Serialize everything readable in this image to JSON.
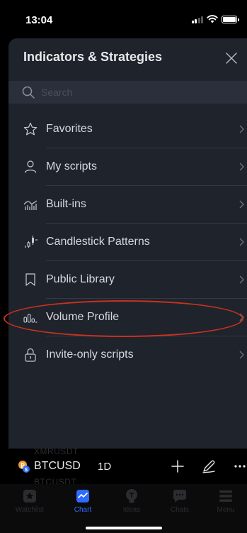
{
  "status_bar": {
    "time": "13:04"
  },
  "panel": {
    "title": "Indicators & Strategies",
    "search_placeholder": "Search",
    "items": [
      {
        "label": "Favorites",
        "icon": "star-icon"
      },
      {
        "label": "My scripts",
        "icon": "user-icon"
      },
      {
        "label": "Built-ins",
        "icon": "built-ins-icon"
      },
      {
        "label": "Candlestick Patterns",
        "icon": "candlestick-icon"
      },
      {
        "label": "Public Library",
        "icon": "bookmark-icon"
      },
      {
        "label": "Volume Profile",
        "icon": "volume-profile-icon"
      },
      {
        "label": "Invite-only scripts",
        "icon": "lock-icon"
      }
    ]
  },
  "ticker_bar": {
    "symbol": "BTCUSD",
    "interval": "1D",
    "ghost_above": "XMRUSDT",
    "ghost_below": "BTCUSDT"
  },
  "tab_bar": {
    "tabs": [
      {
        "label": "Watchlist",
        "icon": "watchlist-icon",
        "active": false
      },
      {
        "label": "Chart",
        "icon": "chart-icon",
        "active": true
      },
      {
        "label": "Ideas",
        "icon": "ideas-icon",
        "active": false
      },
      {
        "label": "Chats",
        "icon": "chats-icon",
        "active": false
      },
      {
        "label": "Menu",
        "icon": "menu-icon",
        "active": false
      }
    ]
  },
  "colors": {
    "panel_bg": "#1f232c",
    "search_bg": "#2a2f3b",
    "active_tab": "#2e6bff",
    "highlight_ring": "#c8321f"
  }
}
